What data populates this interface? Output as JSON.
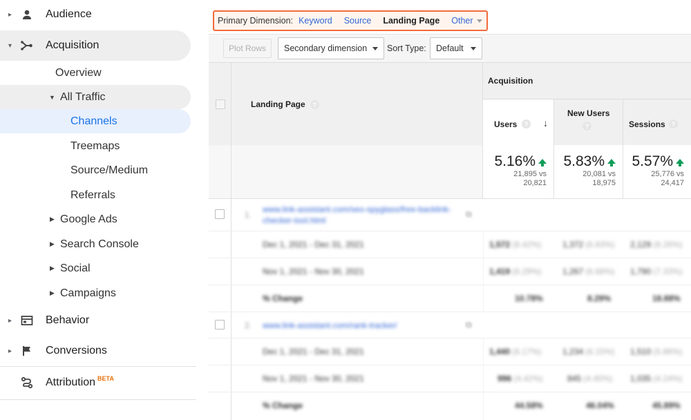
{
  "sidebar": {
    "audience": "Audience",
    "acquisition": "Acquisition",
    "overview": "Overview",
    "all_traffic": "All Traffic",
    "channels": "Channels",
    "treemaps": "Treemaps",
    "source_medium": "Source/Medium",
    "referrals": "Referrals",
    "google_ads": "Google Ads",
    "search_console": "Search Console",
    "social": "Social",
    "campaigns": "Campaigns",
    "behavior": "Behavior",
    "conversions": "Conversions",
    "attribution": "Attribution",
    "beta_badge": "BETA"
  },
  "dimension_bar": {
    "label": "Primary Dimension:",
    "keyword": "Keyword",
    "source": "Source",
    "landing_page": "Landing Page",
    "other": "Other"
  },
  "toolbar": {
    "plot_rows": "Plot Rows",
    "secondary_dimension": "Secondary dimension",
    "sort_type_label": "Sort Type:",
    "sort_type_value": "Default"
  },
  "table": {
    "landing_page_header": "Landing Page",
    "group_header": "Acquisition",
    "help_glyph": "?",
    "sort_arrow": "↓",
    "columns": {
      "users": "Users",
      "new_users": "New Users",
      "sessions": "Sessions"
    },
    "summary": {
      "users": {
        "pct": "5.16%",
        "line1": "21,895 vs",
        "line2": "20,821"
      },
      "new_users": {
        "pct": "5.83%",
        "line1": "20,081 vs",
        "line2": "18,975"
      },
      "sessions": {
        "pct": "5.57%",
        "line1": "25,776 vs",
        "line2": "24,417"
      }
    },
    "rows": [
      {
        "num": "1.",
        "url": "www.link-assistant.com/seo-spyglass/free-backlink-checker-tool.html",
        "d1": "Dec 1, 2021 - Dec 31, 2021",
        "d1_users": "1,572",
        "d1_users_p": "(8.42%)",
        "d1_new": "1,372",
        "d1_new_p": "(6.83%)",
        "d1_sess": "2,129",
        "d1_sess_p": "(8.26%)",
        "d2": "Nov 1, 2021 - Nov 30, 2021",
        "d2_users": "1,419",
        "d2_users_p": "(6.29%)",
        "d2_new": "1,267",
        "d2_new_p": "(6.68%)",
        "d2_sess": "1,790",
        "d2_sess_p": "(7.33%)",
        "chg": "% Change",
        "chg_users": "10.78%",
        "chg_new": "8.29%",
        "chg_sess": "18.88%"
      },
      {
        "num": "2.",
        "url": "www.link-assistant.com/rank-tracker/",
        "d1": "Dec 1, 2021 - Dec 31, 2021",
        "d1_users": "1,440",
        "d1_users_p": "(6.17%)",
        "d1_new": "1,234",
        "d1_new_p": "(6.15%)",
        "d1_sess": "1,510",
        "d1_sess_p": "(5.86%)",
        "d2": "Nov 1, 2021 - Nov 30, 2021",
        "d2_users": "996",
        "d2_users_p": "(4.42%)",
        "d2_new": "845",
        "d2_new_p": "(4.45%)",
        "d2_sess": "1,035",
        "d2_sess_p": "(4.24%)",
        "chg": "% Change",
        "chg_users": "44.58%",
        "chg_new": "46.04%",
        "chg_sess": "45.89%"
      }
    ]
  }
}
